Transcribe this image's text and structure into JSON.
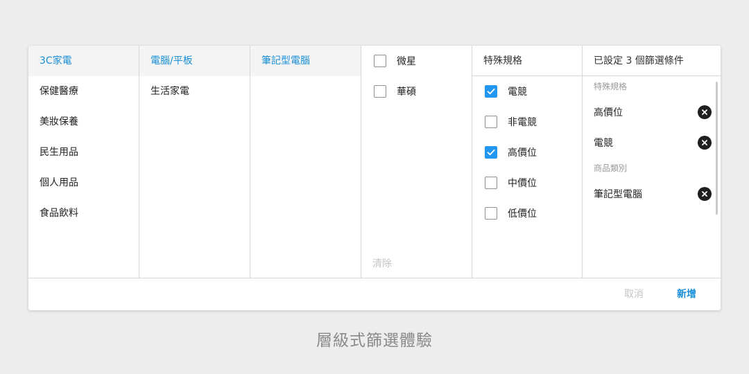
{
  "columns": {
    "level1": {
      "items": [
        {
          "label": "3C家電",
          "active": true
        },
        {
          "label": "保健醫療",
          "active": false
        },
        {
          "label": "美妝保養",
          "active": false
        },
        {
          "label": "民生用品",
          "active": false
        },
        {
          "label": "個人用品",
          "active": false
        },
        {
          "label": "食品飲料",
          "active": false
        }
      ]
    },
    "level2": {
      "items": [
        {
          "label": "電腦/平板",
          "active": true
        },
        {
          "label": "生活家電",
          "active": false
        }
      ]
    },
    "level3": {
      "items": [
        {
          "label": "筆記型電腦",
          "active": true
        }
      ]
    },
    "brands": {
      "items": [
        {
          "label": "微星",
          "checked": false
        },
        {
          "label": "華碩",
          "checked": false
        }
      ],
      "clear_label": "清除"
    },
    "specs": {
      "header": "特殊規格",
      "items": [
        {
          "label": "電競",
          "checked": true
        },
        {
          "label": "非電競",
          "checked": false
        },
        {
          "label": "高價位",
          "checked": true
        },
        {
          "label": "中價位",
          "checked": false
        },
        {
          "label": "低價位",
          "checked": false
        }
      ]
    },
    "selected": {
      "header": "已設定 3 個篩選條件",
      "groups": [
        {
          "title": "特殊規格",
          "items": [
            "高價位",
            "電競"
          ]
        },
        {
          "title": "商品類別",
          "items": [
            "筆記型電腦"
          ]
        }
      ]
    }
  },
  "footer": {
    "cancel_label": "取消",
    "add_label": "新增"
  },
  "caption": "層級式篩選體驗",
  "colors": {
    "accent": "#1a8fd6",
    "checkbox_checked": "#2196f3",
    "muted": "#c4c4c4"
  },
  "icons": {
    "check": "check-icon",
    "remove": "close-circle-icon"
  }
}
